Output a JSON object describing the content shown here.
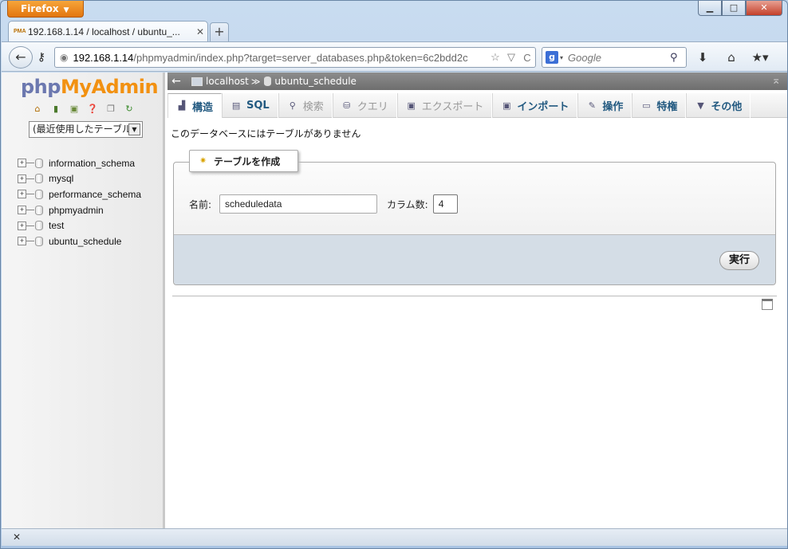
{
  "browser": {
    "menu_label": "Firefox",
    "menu_arrow": "▼",
    "window_controls": {
      "minimize": "▁",
      "maximize": "□",
      "close": "✕"
    },
    "tab": {
      "favicon_text": "PMA",
      "title": "192.168.1.14 / localhost / ubuntu_...",
      "close": "✕"
    },
    "new_tab": "+",
    "url": {
      "host": "192.168.1.14",
      "path": "/phpmyadmin/index.php?target=server_databases.php&token=6c2bdd2c"
    },
    "url_icons": {
      "bookmark": "☆",
      "dropdown": "▽",
      "reload": "C"
    },
    "search": {
      "engine": "g",
      "placeholder": "Google",
      "button": "⚲"
    },
    "nav_icons": {
      "download": "⬇",
      "home": "⌂",
      "bookmarks": "★▾"
    },
    "back": "←",
    "status_close": "✕"
  },
  "sidebar": {
    "logo": {
      "php": "php",
      "my": "My",
      "admin": "Admin"
    },
    "quick_icons": [
      "home-icon",
      "logout-icon",
      "query-window-icon",
      "docs-icon",
      "copy-icon",
      "reload-icon"
    ],
    "select_value": "(最近使用したテーブル)",
    "databases": [
      {
        "name": "information_schema"
      },
      {
        "name": "mysql"
      },
      {
        "name": "performance_schema"
      },
      {
        "name": "phpmyadmin"
      },
      {
        "name": "test"
      },
      {
        "name": "ubuntu_schedule"
      }
    ]
  },
  "breadcrumb": {
    "server": "localhost",
    "database": "ubuntu_schedule",
    "sep": "≫",
    "back": "←",
    "collapse": "⌅"
  },
  "menu_tabs": [
    {
      "label": "構造",
      "icon": "structure-icon",
      "glyph": "▟",
      "state": "active"
    },
    {
      "label": "SQL",
      "icon": "sql-icon",
      "glyph": "▤",
      "state": "normal"
    },
    {
      "label": "検索",
      "icon": "search-icon",
      "glyph": "⚲",
      "state": "disabled"
    },
    {
      "label": "クエリ",
      "icon": "query-icon",
      "glyph": "⛁",
      "state": "disabled"
    },
    {
      "label": "エクスポート",
      "icon": "export-icon",
      "glyph": "▣",
      "state": "disabled"
    },
    {
      "label": "インポート",
      "icon": "import-icon",
      "glyph": "▣",
      "state": "normal"
    },
    {
      "label": "操作",
      "icon": "wrench-icon",
      "glyph": "✎",
      "state": "normal"
    },
    {
      "label": "特権",
      "icon": "privileges-icon",
      "glyph": "▭",
      "state": "normal"
    },
    {
      "label": "その他",
      "icon": "more-icon",
      "glyph": "▼",
      "state": "normal"
    }
  ],
  "main": {
    "message": "このデータベースにはテーブルがありません",
    "create_table": {
      "legend": "テーブルを作成",
      "name_label": "名前:",
      "name_value": "scheduledata",
      "columns_label": "カラム数:",
      "columns_value": "4",
      "go_button": "実行"
    }
  }
}
